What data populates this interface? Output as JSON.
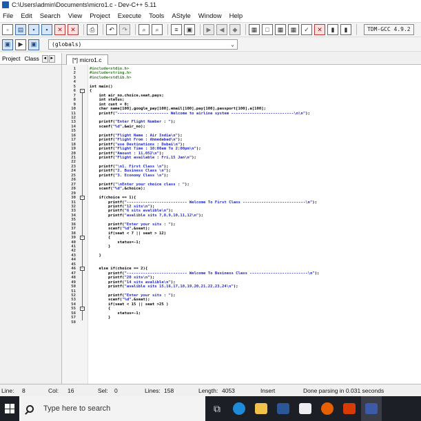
{
  "window": {
    "title": "C:\\Users\\admin\\Documents\\micro1.c - Dev-C++ 5.11"
  },
  "menu": [
    "File",
    "Edit",
    "Search",
    "View",
    "Project",
    "Execute",
    "Tools",
    "AStyle",
    "Window",
    "Help"
  ],
  "toolbar": {
    "compiler": "TDM-GCC 4.9.2",
    "scope": "(globals)"
  },
  "left_panel": {
    "tab_project": "Project",
    "tab_classes": "Class",
    "arrow_left": "◄",
    "arrow_right": "►"
  },
  "editor": {
    "tab_label": "[*] micro1.c",
    "lines": [
      "#include<stdio.h>",
      "#include<string.h>",
      "#include<stdlib.h>",
      "",
      "int main()",
      "{",
      "    int air_no,choice,seat,pays;",
      "    int status;",
      "    int cunt = 0;",
      "    char name[100],google_pay[100],email[100],pay[100],passport[100],a[100];",
      "    printf(\"---------------------- Welcome to airline system ---------------------------\\n\\n\");",
      "",
      "    printf(\"Enter Flight Number : \");",
      "    scanf(\"%d\",&air_no);",
      "",
      "    printf(\"Flight Name : Air India\\n\");",
      "    printf(\"Flight From : Ahmedabad\\n\");",
      "    printf(\"use Destinations : Dubai\\n\");",
      "    printf(\"Flight Time : 10:00am To 2:00pm\\n\");",
      "    printf(\"Amount : 11,052\\n\");",
      "    printf(\"Flight available : Fri,15 Jan\\n\");",
      "",
      "    printf(\"\\n1. First Class \\n\");",
      "    printf(\"2. Business Class \\n\");",
      "    printf(\"3. Economy Class \\n\");",
      "",
      "    printf(\"\\nEnter your choice class : \");",
      "    scanf(\"%d\",&choice);",
      "",
      "    if(choice == 1){",
      "        printf(\"-------------------------- Welcome To First Class ---------------------------\\n\");",
      "        printf(\"12 sits\\n\");",
      "        printf(\"6 sits avalible\\n\");",
      "        printf(\"avalible sits 7,8,9,10,11,12\\n\");",
      "",
      "        printf(\"Enter your sits : \");",
      "        scanf(\"%d\",&seat);",
      "        if(seat < 7 || seat > 12)",
      "        {",
      "            status=-1;",
      "        }",
      "",
      "    }",
      "",
      "",
      "    else if(choice == 2){",
      "        printf(\"-------------------------- Welcome To Business Class -------------------------\\n\");",
      "        printf(\"20 sits\\n\");",
      "        printf(\"14 sits avalible\\n\");",
      "        printf(\"avalible sits 15,16,17,18,19,20,21,22,23,24\\n\");",
      "",
      "        printf(\"Enter your sits : \");",
      "        scanf(\"%d\",&seat);",
      "        if(seat < 15 || seat >25 )",
      "        {",
      "            status=-1;",
      "        }",
      ""
    ]
  },
  "status": {
    "line_label": "Line:",
    "line_value": "8",
    "col_label": "Col:",
    "col_value": "16",
    "sel_label": "Sel:",
    "sel_value": "0",
    "lines_label": "Lines:",
    "lines_value": "158",
    "length_label": "Length:",
    "length_value": "4053",
    "mode": "Insert",
    "message": "Done parsing in 0.031 seconds"
  },
  "taskbar": {
    "search_placeholder": "Type here to search"
  },
  "colors": {
    "preprocessor": "#3c7a2e",
    "string": "#1d25c9",
    "taskbar": "#1d1f26"
  }
}
